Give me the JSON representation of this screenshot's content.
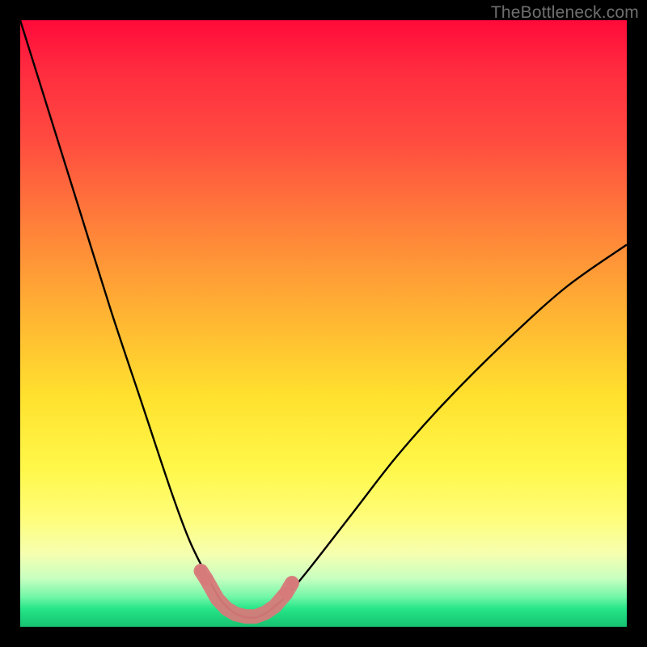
{
  "watermark": {
    "text": "TheBottleneck.com"
  },
  "colors": {
    "curve": "#000000",
    "marker_fill": "#d77a7a",
    "marker_stroke": "#b85a5a",
    "frame": "#000000"
  },
  "chart_data": {
    "type": "line",
    "title": "",
    "xlabel": "",
    "ylabel": "",
    "xlim": [
      0,
      100
    ],
    "ylim": [
      0,
      100
    ],
    "grid": false,
    "legend": false,
    "series": [
      {
        "name": "bottleneck-curve",
        "x": [
          0,
          5,
          10,
          15,
          20,
          25,
          28,
          31,
          33,
          35,
          37,
          39,
          41,
          44,
          48,
          55,
          62,
          70,
          80,
          90,
          100
        ],
        "y": [
          100,
          84,
          68,
          52,
          37,
          22,
          14,
          8,
          4.5,
          2.5,
          1.6,
          1.6,
          2.6,
          5.2,
          10,
          19,
          28,
          37,
          47,
          56,
          63
        ]
      }
    ],
    "markers": {
      "name": "highlight-points",
      "x": [
        29.8,
        30.7,
        32.5,
        34.0,
        35.5,
        37.2,
        38.8,
        40.4,
        42.0,
        43.8,
        44.8
      ],
      "y": [
        9.2,
        7.8,
        4.6,
        3.0,
        2.1,
        1.7,
        1.7,
        2.3,
        3.4,
        5.5,
        7.2
      ]
    }
  }
}
